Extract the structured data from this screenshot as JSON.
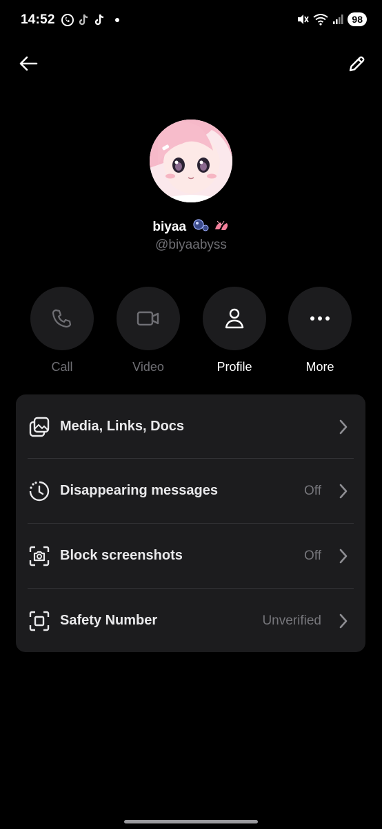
{
  "status_bar": {
    "time": "14:52",
    "battery": "98"
  },
  "header": {
    "back_icon": "arrow-left-icon",
    "edit_icon": "pencil-icon"
  },
  "profile": {
    "name": "biyaa",
    "handle": "@biyaabyss"
  },
  "actions": [
    {
      "label": "Call",
      "icon": "phone-icon",
      "enabled": false
    },
    {
      "label": "Video",
      "icon": "video-icon",
      "enabled": false
    },
    {
      "label": "Profile",
      "icon": "person-icon",
      "enabled": true
    },
    {
      "label": "More",
      "icon": "more-icon",
      "enabled": true
    }
  ],
  "settings": [
    {
      "title": "Media, Links, Docs",
      "value": "",
      "icon": "media-icon"
    },
    {
      "title": "Disappearing messages",
      "value": "Off",
      "icon": "timer-icon"
    },
    {
      "title": "Block screenshots",
      "value": "Off",
      "icon": "screenshot-camera-icon"
    },
    {
      "title": "Safety Number",
      "value": "Unverified",
      "icon": "safety-number-icon"
    }
  ]
}
